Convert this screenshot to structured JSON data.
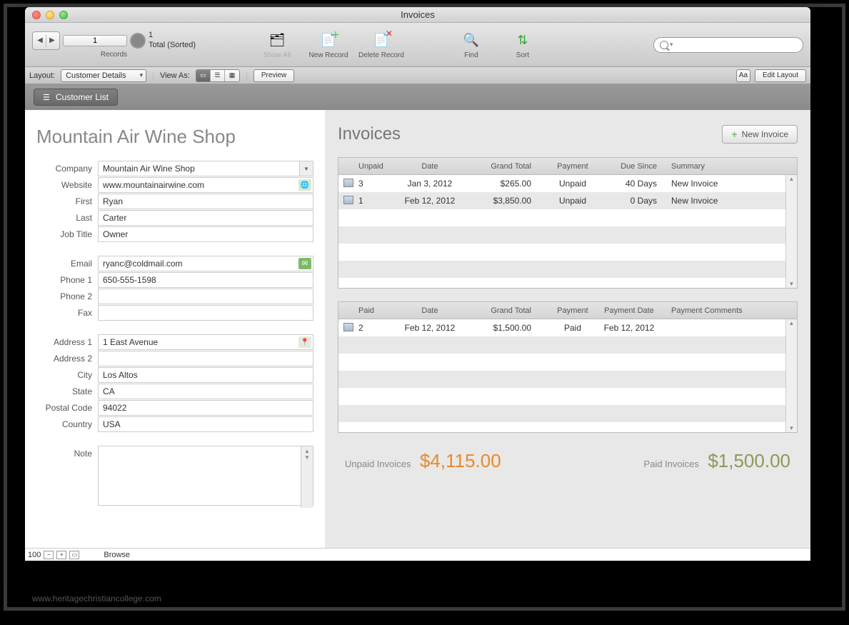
{
  "window": {
    "title": "Invoices"
  },
  "toolbar": {
    "record_num": "1",
    "total_line1": "1",
    "total_line2": "Total (Sorted)",
    "records_label": "Records",
    "show_all": "Show All",
    "new_record": "New Record",
    "delete_record": "Delete Record",
    "find": "Find",
    "sort": "Sort"
  },
  "layoutbar": {
    "layout_label": "Layout:",
    "layout_value": "Customer Details",
    "viewas_label": "View As:",
    "preview": "Preview",
    "aa": "Aa",
    "edit_layout": "Edit Layout"
  },
  "subheader": {
    "customer_list": "Customer List"
  },
  "customer": {
    "name": "Mountain Air Wine Shop",
    "labels": {
      "company": "Company",
      "website": "Website",
      "first": "First",
      "last": "Last",
      "jobtitle": "Job Title",
      "email": "Email",
      "phone1": "Phone 1",
      "phone2": "Phone 2",
      "fax": "Fax",
      "address1": "Address 1",
      "address2": "Address 2",
      "city": "City",
      "state": "State",
      "postal": "Postal Code",
      "country": "Country",
      "note": "Note"
    },
    "values": {
      "company": "Mountain Air Wine Shop",
      "website": "www.mountainairwine.com",
      "first": "Ryan",
      "last": "Carter",
      "jobtitle": "Owner",
      "email": "ryanc@coldmail.com",
      "phone1": "650-555-1598",
      "phone2": "",
      "fax": "",
      "address1": "1 East Avenue",
      "address2": "",
      "city": "Los Altos",
      "state": "CA",
      "postal": "94022",
      "country": "USA",
      "note": ""
    }
  },
  "invoices": {
    "heading": "Invoices",
    "new_invoice": "New Invoice",
    "unpaid_headers": {
      "c1": "Unpaid",
      "c2": "Date",
      "c3": "Grand Total",
      "c4": "Payment",
      "c5": "Due Since",
      "c6": "Summary"
    },
    "unpaid_rows": [
      {
        "num": "3",
        "date": "Jan 3, 2012",
        "total": "$265.00",
        "payment": "Unpaid",
        "due": "40 Days",
        "summary": "New Invoice"
      },
      {
        "num": "1",
        "date": "Feb 12, 2012",
        "total": "$3,850.00",
        "payment": "Unpaid",
        "due": "0 Days",
        "summary": "New Invoice"
      }
    ],
    "paid_headers": {
      "c1": "Paid",
      "c2": "Date",
      "c3": "Grand Total",
      "c4": "Payment",
      "c5": "Payment Date",
      "c6": "Payment Comments"
    },
    "paid_rows": [
      {
        "num": "2",
        "date": "Feb 12, 2012",
        "total": "$1,500.00",
        "payment": "Paid",
        "pdate": "Feb 12, 2012",
        "comments": ""
      }
    ],
    "totals": {
      "unpaid_label": "Unpaid Invoices",
      "unpaid_value": "$4,115.00",
      "paid_label": "Paid Invoices",
      "paid_value": "$1,500.00"
    }
  },
  "statusbar": {
    "zoom": "100",
    "mode": "Browse"
  },
  "watermark": "www.heritagechristiancollege.com"
}
